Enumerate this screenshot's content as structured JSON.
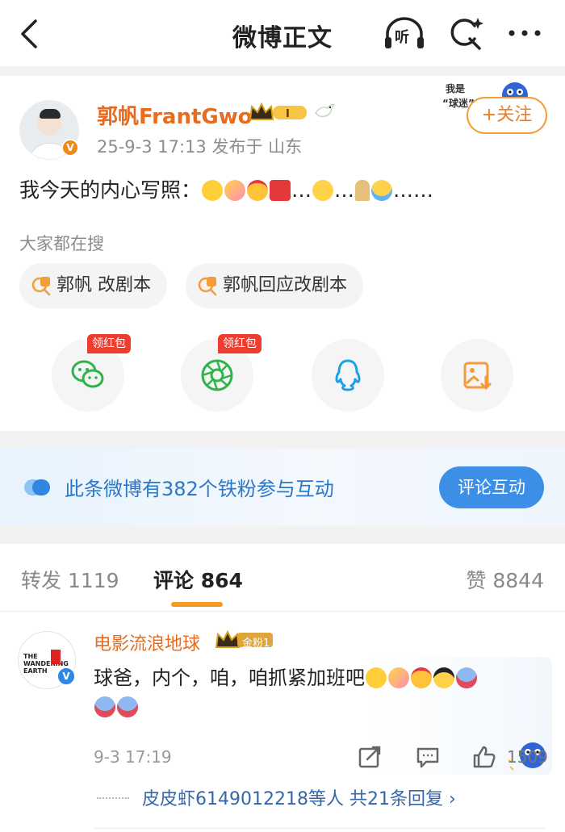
{
  "header": {
    "title": "微博正文",
    "listen_label": "听",
    "back_icon": "back-arrow-icon",
    "refresh_icon": "refresh-spark-icon",
    "more_icon": "more-dots-icon"
  },
  "post": {
    "author": "郭帆FrantGwo",
    "vip_level": "I",
    "meta": "25-9-3 17:13  发布于 山东",
    "follow_label": "+关注",
    "text_prefix": "我今天的内心写照：",
    "text_dots": "…",
    "text_tail": "……",
    "search_title": "大家都在搜",
    "search_chips": [
      "郭帆 改剧本",
      "郭帆回应改剧本"
    ],
    "share_badges": [
      "领红包",
      "领红包"
    ],
    "sticker_text": "我是“球迷”"
  },
  "fans_banner": {
    "text": "此条微博有382个铁粉参与互动",
    "button": "评论互动"
  },
  "tabs": {
    "repost": "转发 1119",
    "comment": "评论 864",
    "like": "赞 8844"
  },
  "comment": {
    "author": "电影流浪地球",
    "fan_badge": "金粉1",
    "text": "球爸，内个，咱，咱抓紧加班吧",
    "time": "9-3 17:19",
    "like_count": "1509",
    "replies": "皮皮虾6149012218等人 共21条回复 ›",
    "avatar_text": "THE WANDERING EARTH"
  },
  "colors": {
    "accent_orange": "#e86b1e",
    "link_blue": "#3567a8",
    "banner_blue": "#2b77c8",
    "button_blue": "#3b8fe6"
  }
}
